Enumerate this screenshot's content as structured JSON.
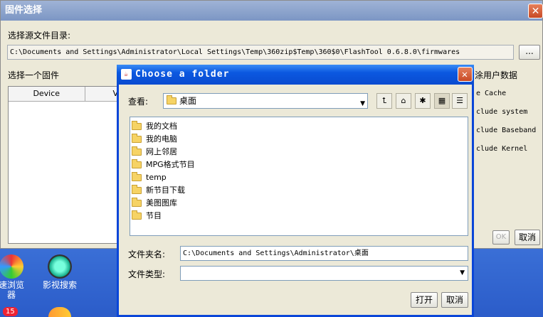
{
  "bg_window": {
    "title": "固件选择",
    "source_dir_label": "选择源文件目录:",
    "source_dir_path": "C:\\Documents and Settings\\Administrator\\Local Settings\\Temp\\360zip$Temp\\360$0\\FlashTool 0.6.8.0\\firmwares",
    "browse_label": "...",
    "choose_firmware_label": "选择一个固件",
    "table_headers": [
      "Device",
      "V"
    ],
    "wipe_label": "涂用户数据",
    "options": [
      "e Cache",
      "clude system",
      "clude Baseband",
      "clude Kernel"
    ],
    "ok_label": "OK",
    "cancel_label": "取消"
  },
  "desktop": {
    "icons": [
      {
        "label": "速浏览\n器"
      },
      {
        "label": "影视搜索"
      }
    ],
    "badge": "15"
  },
  "dialog": {
    "title": "Choose a folder",
    "look_in_label": "查看:",
    "look_in_value": "桌面",
    "items": [
      "我的文档",
      "我的电脑",
      "网上邻居",
      "MPG格式节目",
      "temp",
      "新节目下载",
      "美图图库",
      "节目"
    ],
    "folder_name_label": "文件夹名:",
    "folder_name_value": "C:\\Documents and Settings\\Administrator\\桌面",
    "file_type_label": "文件类型:",
    "file_type_value": "",
    "open_label": "打开",
    "cancel_label": "取消"
  }
}
